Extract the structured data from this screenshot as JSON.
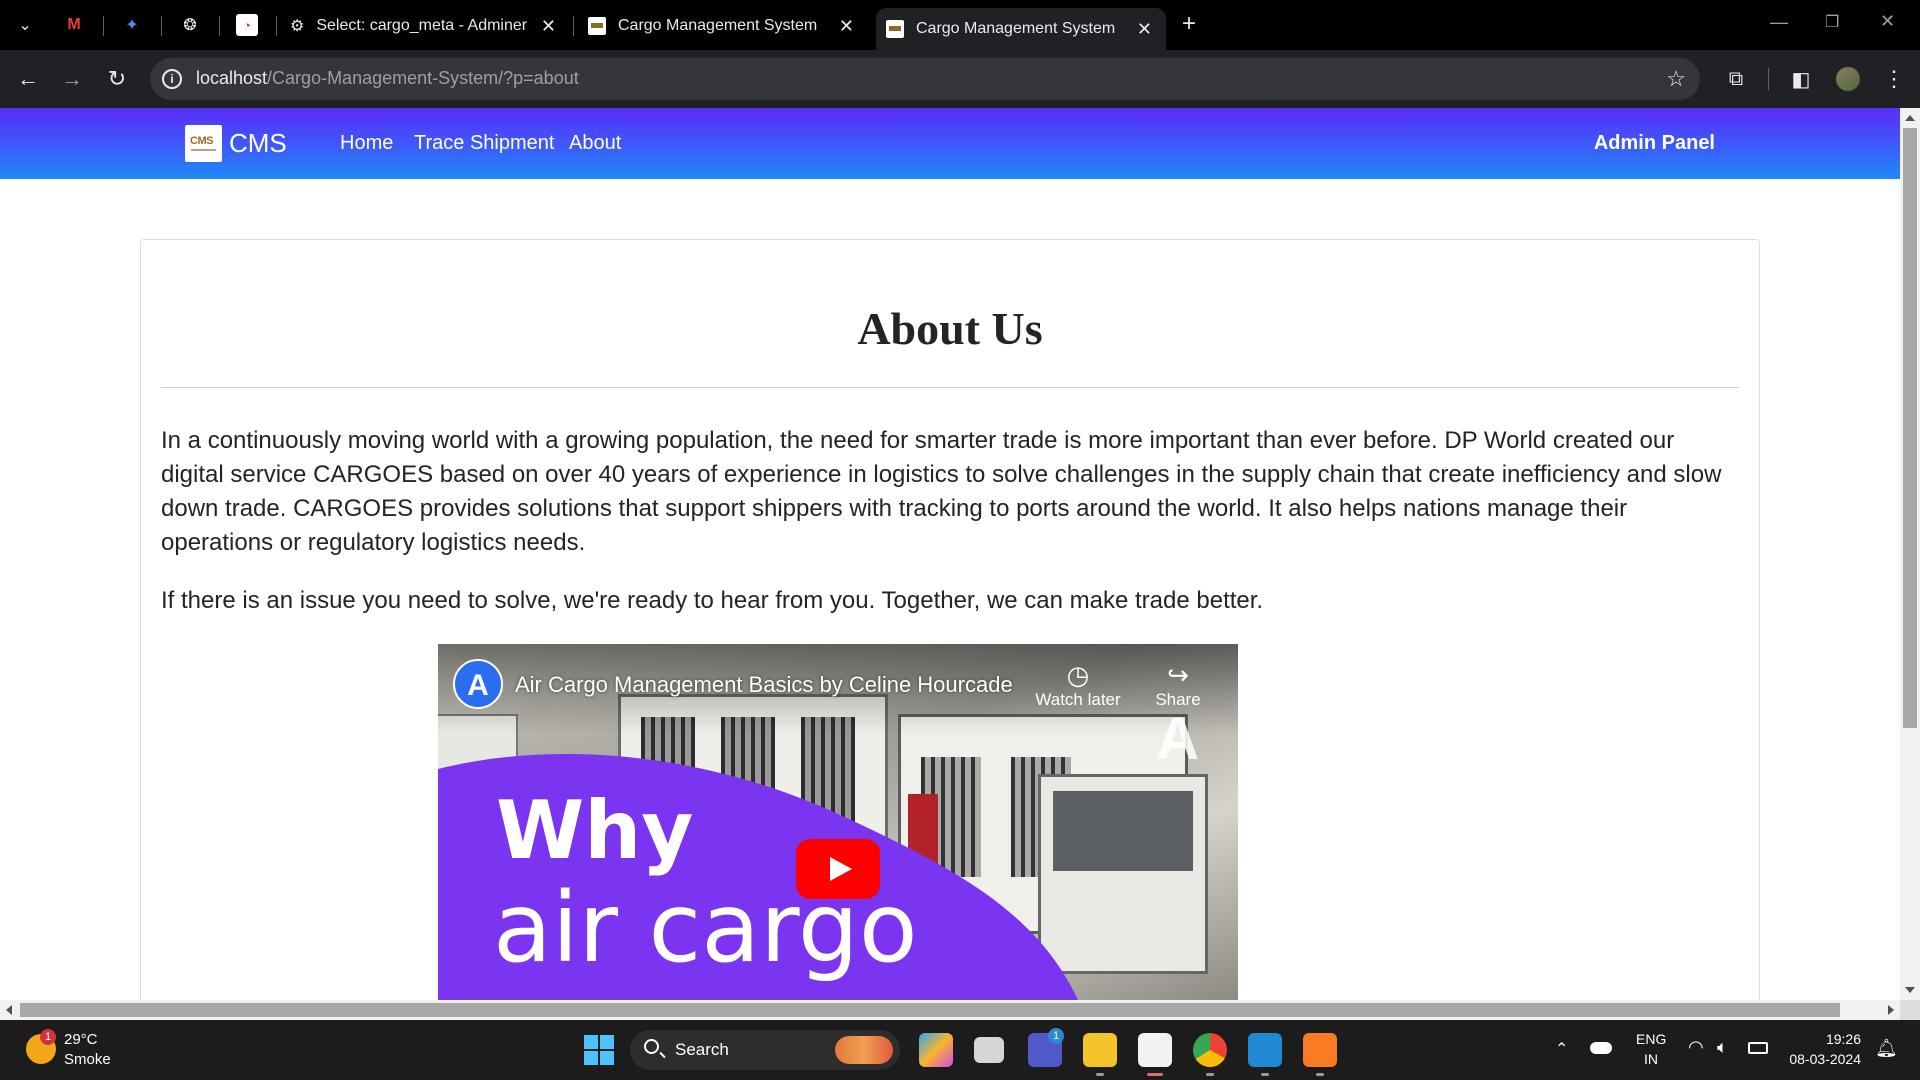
{
  "browser": {
    "tabs": [
      {
        "title": "Select: cargo_meta - Adminer",
        "active": false
      },
      {
        "title": "Cargo Management System",
        "active": false
      },
      {
        "title": "Cargo Management System",
        "active": true
      }
    ],
    "new_tab_label": "+",
    "close_glyph": "✕",
    "address": {
      "host": "localhost",
      "path": "/Cargo-Management-System/?p=about"
    }
  },
  "navbar": {
    "logo_mark": "CMS",
    "brand": "CMS",
    "links": [
      "Home",
      "Trace Shipment",
      "About"
    ],
    "admin_link": "Admin Panel"
  },
  "main": {
    "title": "About Us",
    "paragraphs": [
      "In a continuously moving world with a growing population, the need for smarter trade is more important than ever before. DP World created our digital service CARGOES based on over 40 years of experience in logistics to solve challenges in the supply chain that create inefficiency and slow down trade. CARGOES provides solutions that support shippers with tracking to ports around the world. It also helps nations manage their operations or regulatory logistics needs.",
      "If there is an issue you need to solve, we're ready to hear from you. Together, we can make trade better."
    ]
  },
  "video": {
    "channel_initial": "A",
    "title": "Air Cargo Management Basics by Celine Hourcade",
    "watch_later": "Watch later",
    "share": "Share",
    "thumb_line1": "Why",
    "thumb_line2": "air cargo",
    "accent_color": "#7b35f0"
  },
  "taskbar": {
    "weather_temp": "29°C",
    "weather_condition": "Smoke",
    "weather_badge": "1",
    "search_label": "Search",
    "teams_badge": "1",
    "lang_line1": "ENG",
    "lang_line2": "IN",
    "time": "19:26",
    "date": "08-03-2024"
  }
}
